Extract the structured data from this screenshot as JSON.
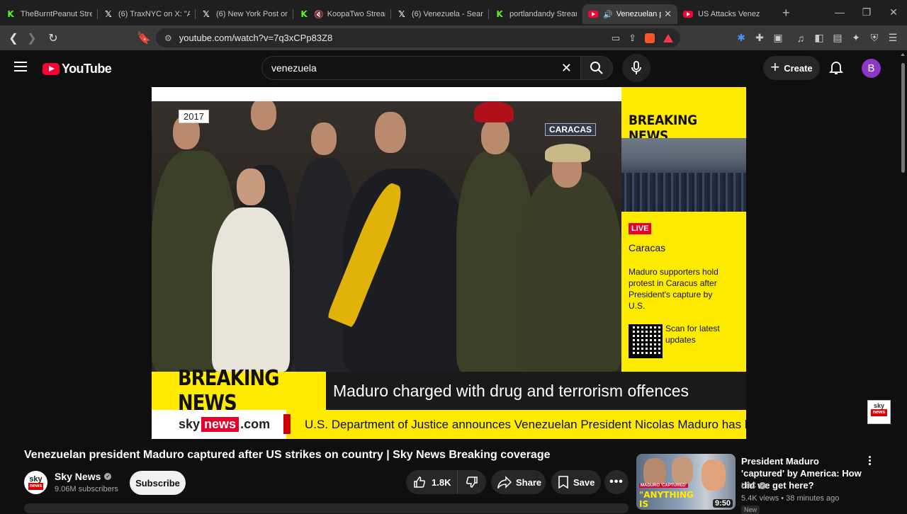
{
  "browser": {
    "tabs": [
      {
        "title": "TheBurntPeanut Strea",
        "icon": "kick-icon"
      },
      {
        "title": "(6) TraxNYC on X: \"An",
        "icon": "x-icon"
      },
      {
        "title": "(6) New York Post on",
        "icon": "x-icon"
      },
      {
        "title": "KoopaTwo Stream",
        "icon": "kick-icon"
      },
      {
        "title": "(6) Venezuela - Searc",
        "icon": "x-icon"
      },
      {
        "title": "portlandandy Stream",
        "icon": "kick-icon"
      },
      {
        "title": "Venezuelan pr",
        "icon": "youtube-icon",
        "active": true
      },
      {
        "title": "US Attacks Venez",
        "icon": "youtube-icon"
      }
    ],
    "url": "youtube.com/watch?v=7q3xCPp83Z8"
  },
  "youtube": {
    "logo_text": "YouTube",
    "search_value": "venezuela",
    "create_label": "Create",
    "avatar_letter": "B"
  },
  "video": {
    "overlay": {
      "year": "2017",
      "location": "CARACAS",
      "side_title": "BREAKING NEWS",
      "live": "LIVE",
      "city": "Caracas",
      "description": "Maduro supporters hold protest in Caracus after President's capture  by U.S.",
      "qr_text": "Scan for latest updates",
      "breaking": "BREAKING NEWS",
      "headline": "Maduro charged with drug and terrorism offences",
      "brand_sky": "sky",
      "brand_news": "news",
      "brand_com": ".com",
      "ticker": "U.S. Department of Justice announces Venezuelan President Nicolas Maduro has been",
      "watermark_sky": "sky",
      "watermark_news": "news"
    },
    "title": "Venezuelan president Maduro captured after US strikes on country | Sky News Breaking coverage",
    "channel": {
      "name": "Sky News",
      "subscribers": "9.06M subscribers",
      "avatar_sky": "sky",
      "avatar_news": "news"
    },
    "subscribe_label": "Subscribe",
    "likes": "1.8K",
    "share_label": "Share",
    "save_label": "Save"
  },
  "recommended": [
    {
      "title": "President Maduro 'captured' by America: How did we get here?",
      "channel": "LBC",
      "meta": "5.4K views • 38 minutes ago",
      "badge": "New",
      "duration": "9:50",
      "thumb_tag": "MADURO 'CAPTURED'",
      "thumb_text": "\"ANYTHING IS POSSIBLE NOW\""
    }
  ]
}
